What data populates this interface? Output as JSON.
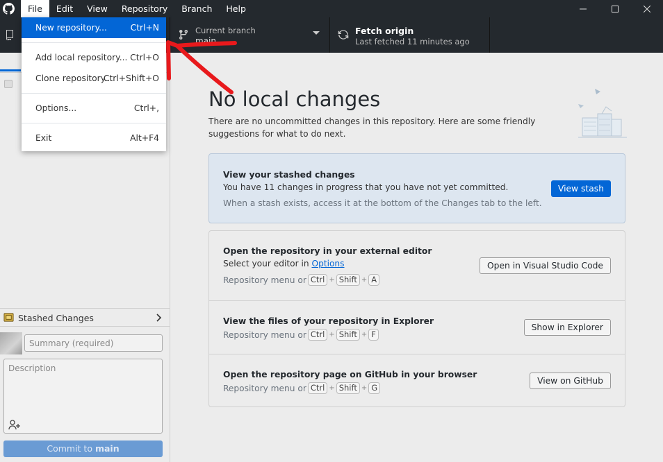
{
  "menubar": {
    "items": [
      "File",
      "Edit",
      "View",
      "Repository",
      "Branch",
      "Help"
    ],
    "active_index": 0
  },
  "window_controls": [
    "minimize",
    "maximize",
    "close"
  ],
  "toolbar": {
    "branch": {
      "title": "Current branch",
      "value": "main"
    },
    "fetch": {
      "title": "Fetch origin",
      "subtitle": "Last fetched 11 minutes ago"
    }
  },
  "file_menu": {
    "items": [
      {
        "label": "New repository...",
        "accelerator": "Ctrl+N"
      },
      {
        "label": "Add local repository...",
        "accelerator": "Ctrl+O"
      },
      {
        "label": "Clone repository...",
        "accelerator": "Ctrl+Shift+O"
      },
      {
        "label": "Options...",
        "accelerator": "Ctrl+,"
      },
      {
        "label": "Exit",
        "accelerator": "Alt+F4"
      }
    ],
    "highlighted_index": 0
  },
  "sidebar": {
    "stashed_label": "Stashed Changes",
    "summary_placeholder": "Summary (required)",
    "description_placeholder": "Description",
    "commit_prefix": "Commit to ",
    "commit_branch": "main"
  },
  "main": {
    "title": "No local changes",
    "description": "There are no uncommitted changes in this repository. Here are some friendly suggestions for what to do next.",
    "stash_card": {
      "title": "View your stashed changes",
      "text": "You have 11 changes in progress that you have not yet committed.",
      "hint": "When a stash exists, access it at the bottom of the Changes tab to the left.",
      "button": "View stash"
    },
    "editor_row": {
      "title": "Open the repository in your external editor",
      "text_prefix": "Select your editor in ",
      "text_link": "Options",
      "menu_prefix": "Repository menu or",
      "keys": [
        "Ctrl",
        "Shift",
        "A"
      ],
      "button": "Open in Visual Studio Code"
    },
    "explorer_row": {
      "title": "View the files of your repository in Explorer",
      "menu_prefix": "Repository menu or",
      "keys": [
        "Ctrl",
        "Shift",
        "F"
      ],
      "button": "Show in Explorer"
    },
    "github_row": {
      "title": "Open the repository page on GitHub in your browser",
      "menu_prefix": "Repository menu or",
      "keys": [
        "Ctrl",
        "Shift",
        "G"
      ],
      "button": "View on GitHub"
    }
  },
  "colors": {
    "accent": "#0366d6",
    "titlebar": "#24292e",
    "annotation": "#e8191c"
  }
}
